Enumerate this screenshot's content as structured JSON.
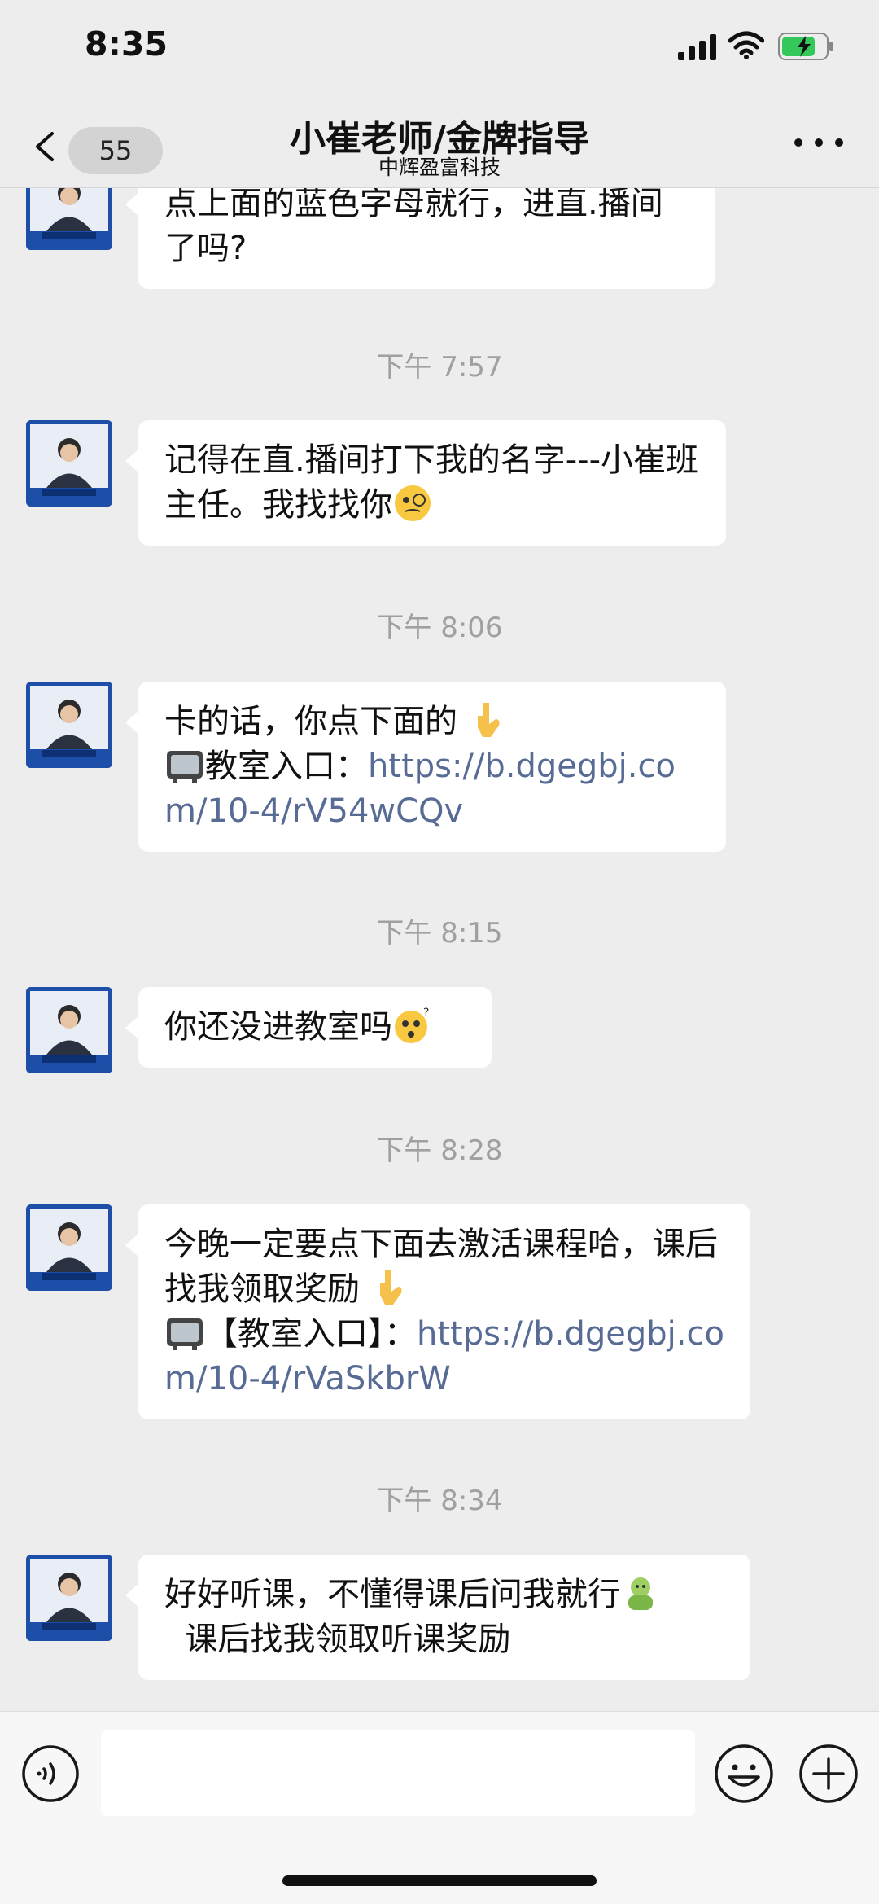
{
  "status_bar": {
    "time": "8:35",
    "icons": [
      "signal-icon",
      "wifi-icon",
      "battery-charging-icon"
    ]
  },
  "nav": {
    "unread_count": "55",
    "title": "小崔老师/金牌指导",
    "subtitle": "中辉盈富科技"
  },
  "messages": [
    {
      "type": "text",
      "text": "点上面的蓝色字母就行，进直.播间了吗?"
    },
    {
      "type": "time",
      "text": "下午 7:57"
    },
    {
      "type": "text",
      "text": "记得在直.播间打下我的名字---小崔班主任。我找找你",
      "emoji": "monocle-face-emoji"
    },
    {
      "type": "time",
      "text": "下午 8:06"
    },
    {
      "type": "text",
      "text_before": "卡的话，你点下面的",
      "emoji": "pointing-down-emoji",
      "line2_prefix": "教室入口：",
      "link": "https://b.dgegbj.com/10-4/rV54wCQv",
      "tv_emoji": "television-emoji"
    },
    {
      "type": "time",
      "text": "下午 8:15"
    },
    {
      "type": "text",
      "text": "你还没进教室吗",
      "emoji": "thinking-face-emoji"
    },
    {
      "type": "time",
      "text": "下午 8:28"
    },
    {
      "type": "text",
      "text_before": "今晚一定要点下面去激活课程哈，课后找我领取奖励",
      "emoji": "pointing-down-emoji",
      "line2_prefix": "【教室入口】：",
      "link": "https://b.dgegbj.com/10-4/rVaSkbrW",
      "tv_emoji": "television-emoji"
    },
    {
      "type": "time",
      "text": "下午 8:34"
    },
    {
      "type": "text",
      "text_before": "好好听课，不懂得课后问我就行",
      "emoji": "sloth-emoji",
      "text_after": "  课后找我领取听课奖励"
    }
  ],
  "input_bar": {
    "icons": [
      "voice-icon",
      "emoji-icon",
      "plus-icon"
    ],
    "text_value": ""
  },
  "colors": {
    "background": "#ededed",
    "bubble": "#ffffff",
    "link": "#576b95",
    "time": "#a0a0a0"
  }
}
